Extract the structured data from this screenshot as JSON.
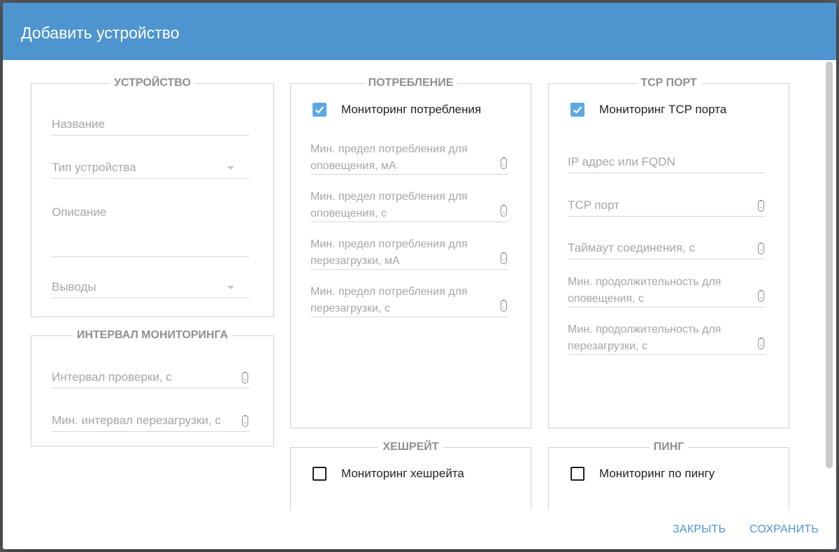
{
  "dialog": {
    "title": "Добавить устройство",
    "accent_color": "#4e94cf"
  },
  "device": {
    "legend": "УСТРОЙСТВО",
    "name_placeholder": "Название",
    "type_placeholder": "Тип устройства",
    "description_placeholder": "Описание",
    "outputs_placeholder": "Выводы"
  },
  "interval": {
    "legend": "ИНТЕРВАЛ МОНИТОРИНГА",
    "check_interval": "Интервал проверки, с",
    "min_reboot_interval": "Мин. интервал перезагрузки, с"
  },
  "consumption": {
    "legend": "ПОТРЕБЛЕНИЕ",
    "checkbox_label": "Мониторинг потребления",
    "checked": true,
    "fields": [
      "Мин. предел потребления для\nоповещения, мА",
      "Мин. предел потребления для\nоповещения, с",
      "Мин. предел потребления для\nперезагрузки, мА",
      "Мин. предел потребления для\nперезагрузки, с"
    ]
  },
  "tcp": {
    "legend": "TCP ПОРТ",
    "checkbox_label": "Мониторинг TCP порта",
    "checked": true,
    "ip_placeholder": "IP адрес или FQDN",
    "port_placeholder": "TCP порт",
    "timeout_placeholder": "Таймаут соединения, с",
    "min_alert_duration": "Мин. продолжительность для\nоповещения, с",
    "min_reboot_duration": "Мин. продолжительность для\nперезагрузки, с"
  },
  "hashrate": {
    "legend": "ХЕШРЕЙТ",
    "checkbox_label": "Мониторинг хешрейта",
    "checked": false
  },
  "ping": {
    "legend": "ПИНГ",
    "checkbox_label": "Мониторинг по пингу",
    "checked": false
  },
  "actions": {
    "close_label": "ЗАКРЫТЬ",
    "save_label": "СОХРАНИТЬ"
  },
  "icons": {
    "checkbox_checked": "check-icon",
    "dropdown": "chevron-down-icon",
    "spinner": "spinner-arrows-icon"
  }
}
